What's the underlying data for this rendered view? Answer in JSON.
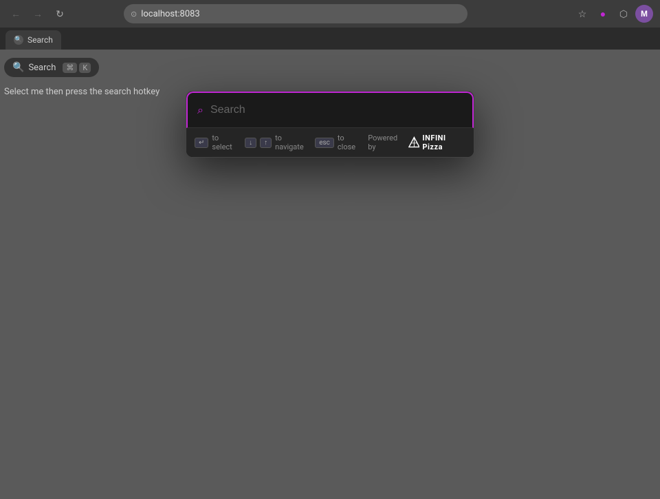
{
  "browser": {
    "url": "localhost:8083",
    "tab_title": "Search",
    "back_label": "←",
    "forward_label": "→",
    "reload_label": "↻",
    "avatar_initial": "M"
  },
  "search_pill": {
    "text": "Search",
    "shortcut_1": "⌘",
    "shortcut_2": "K"
  },
  "helper_text": "Select me then press the search hotkey",
  "search_modal": {
    "placeholder": "Search",
    "hint_select_key": "↵",
    "hint_select_label": "to select",
    "hint_nav_down_key": "↓",
    "hint_nav_up_key": "↑",
    "hint_nav_label": "to navigate",
    "hint_close_key": "esc",
    "hint_close_label": "to close",
    "powered_by_label": "Powered by",
    "brand_name": "INFINI Pizza"
  }
}
